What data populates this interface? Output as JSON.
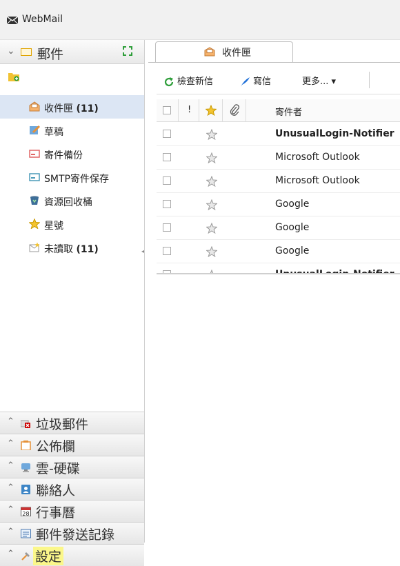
{
  "app": {
    "title": "WebMail"
  },
  "sidebar": {
    "mail_header": "郵件",
    "folders": [
      {
        "label": "收件匣",
        "count": "(11)",
        "icon": "inbox-icon",
        "selected": true
      },
      {
        "label": "草稿",
        "count": "",
        "icon": "drafts-icon"
      },
      {
        "label": "寄件備份",
        "count": "",
        "icon": "sent-icon"
      },
      {
        "label": "SMTP寄件保存",
        "count": "",
        "icon": "smtp-saved-icon"
      },
      {
        "label": "資源回收桶",
        "count": "",
        "icon": "trash-icon"
      },
      {
        "label": "星號",
        "count": "",
        "icon": "star-icon"
      },
      {
        "label": "未讀取",
        "count": "(11)",
        "icon": "unread-icon"
      }
    ],
    "panels": [
      {
        "label": "垃圾郵件",
        "icon": "spam-icon"
      },
      {
        "label": "公佈欄",
        "icon": "bulletin-icon"
      },
      {
        "label": "雲-硬碟",
        "icon": "cloud-drive-icon"
      },
      {
        "label": "聯絡人",
        "icon": "contacts-icon"
      },
      {
        "label": "行事曆",
        "icon": "calendar-icon",
        "calendar_day": "28"
      },
      {
        "label": "郵件發送記錄",
        "icon": "send-log-icon"
      },
      {
        "label": "設定",
        "icon": "settings-icon",
        "highlighted": true
      }
    ]
  },
  "main": {
    "tab_label": "收件匣",
    "toolbar": {
      "check_new": "檢查新信",
      "compose": "寫信",
      "more": "更多... ▾"
    },
    "columns": {
      "priority": "!",
      "sender": "寄件者"
    },
    "rows": [
      {
        "sender": "UnusualLogin-Notifier",
        "unread": true
      },
      {
        "sender": "Microsoft Outlook",
        "unread": false
      },
      {
        "sender": "Microsoft Outlook",
        "unread": false
      },
      {
        "sender": "Google",
        "unread": false
      },
      {
        "sender": "Google",
        "unread": false
      },
      {
        "sender": "Google",
        "unread": false
      },
      {
        "sender": "UnusualLogin-Notifier",
        "unread": true
      }
    ]
  },
  "colors": {
    "selected_folder": "#dce6f4",
    "highlight": "#fbf78a",
    "accent_green": "#2e9e3a",
    "accent_blue": "#1d6fd8"
  }
}
